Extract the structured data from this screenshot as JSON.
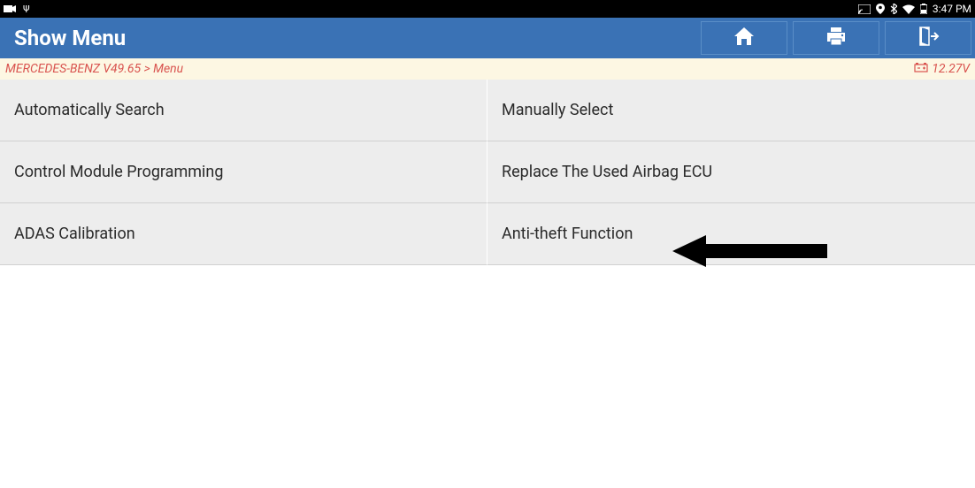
{
  "status_bar": {
    "time": "3:47 PM"
  },
  "header": {
    "title": "Show Menu"
  },
  "breadcrumb": {
    "path": "MERCEDES-BENZ V49.65 > Menu",
    "voltage": "12.27V"
  },
  "menu": {
    "items": [
      {
        "label": "Automatically Search"
      },
      {
        "label": "Manually Select"
      },
      {
        "label": "Control Module Programming"
      },
      {
        "label": "Replace The Used Airbag ECU"
      },
      {
        "label": "ADAS Calibration"
      },
      {
        "label": "Anti-theft Function"
      }
    ]
  }
}
